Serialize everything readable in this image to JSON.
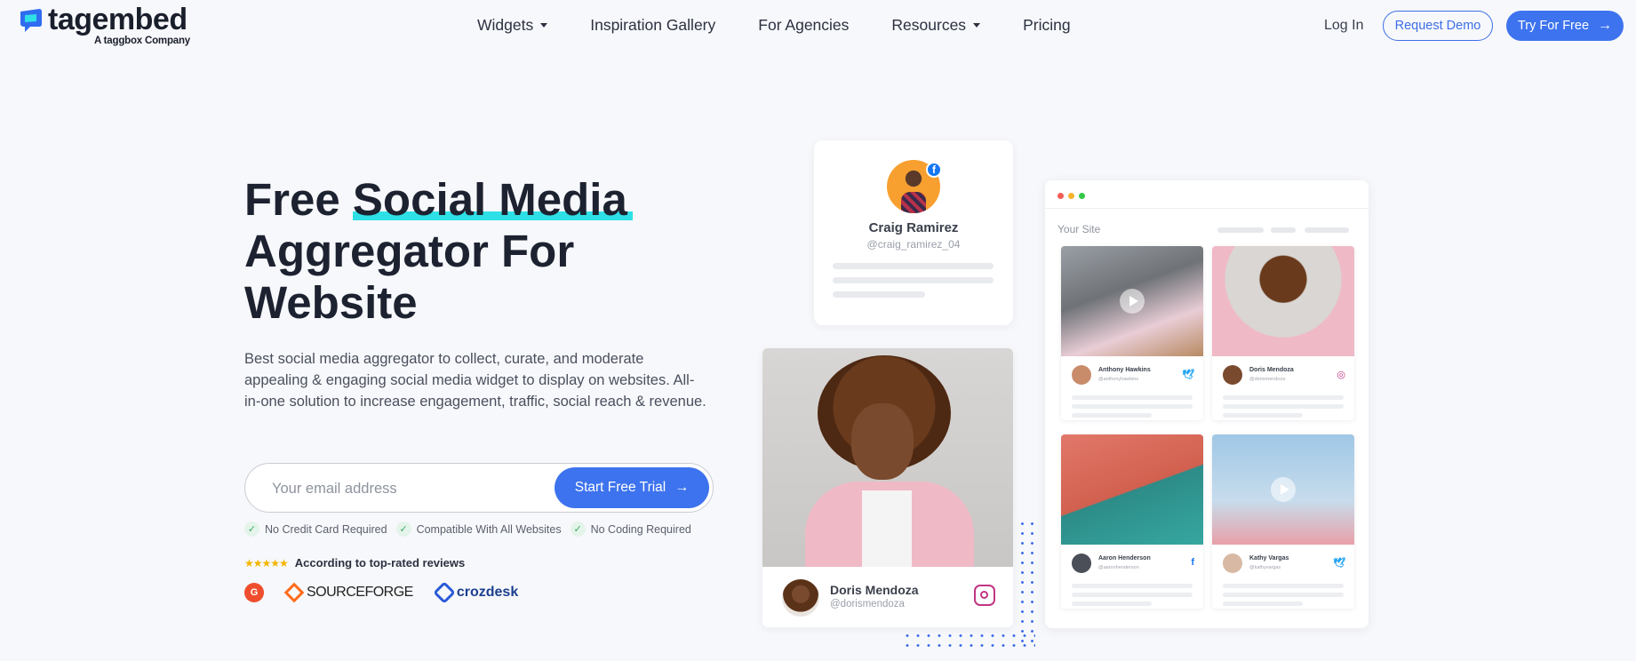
{
  "brand": {
    "name": "tagembed",
    "tagline": "A taggbox Company",
    "accent": "#3d73ee",
    "highlight": "#2ee0e6"
  },
  "nav": {
    "items": [
      {
        "label": "Widgets",
        "dropdown": true
      },
      {
        "label": "Inspiration Gallery",
        "dropdown": false
      },
      {
        "label": "For Agencies",
        "dropdown": false
      },
      {
        "label": "Resources",
        "dropdown": true
      },
      {
        "label": "Pricing",
        "dropdown": false
      }
    ],
    "login": "Log In",
    "demo": "Request Demo",
    "try": "Try For Free",
    "try_icon": "arrow-right-icon"
  },
  "hero": {
    "title_prefix": "Free ",
    "title_highlight": "Social Media",
    "title_rest": "Aggregator For Website",
    "description": "Best social media aggregator to collect, curate, and moderate appealing & engaging social media widget to display on websites. All-in-one solution to increase engagement, traffic, social reach & revenue.",
    "email_placeholder": "Your email address",
    "cta": "Start Free Trial",
    "checks": [
      "No Credit Card Required",
      "Compatible With All Websites",
      "No Coding Required"
    ],
    "rating_text": "According to top-rated reviews",
    "stars": "★★★★★",
    "review_sites": {
      "g2": "G",
      "sourceforge": "SOURCEFORGE",
      "crozdesk": "crozdesk"
    }
  },
  "visual": {
    "profile_card": {
      "name": "Craig Ramirez",
      "handle": "@craig_ramirez_04",
      "network": "facebook-icon"
    },
    "photo_card": {
      "name": "Doris Mendoza",
      "handle": "@dorismendoza",
      "network": "instagram-icon"
    },
    "browser": {
      "site_label": "Your Site",
      "tiles": [
        {
          "name": "Anthony Hawkins",
          "handle": "@anthonyhawkins",
          "network": "twitter-icon"
        },
        {
          "name": "Doris Mendoza",
          "handle": "@dorismendoza",
          "network": "instagram-icon"
        },
        {
          "name": "Aaron Henderson",
          "handle": "@aaronhenderson",
          "network": "facebook-icon"
        },
        {
          "name": "Kathy Vargas",
          "handle": "@kathyvargas",
          "network": "twitter-icon"
        }
      ]
    }
  }
}
